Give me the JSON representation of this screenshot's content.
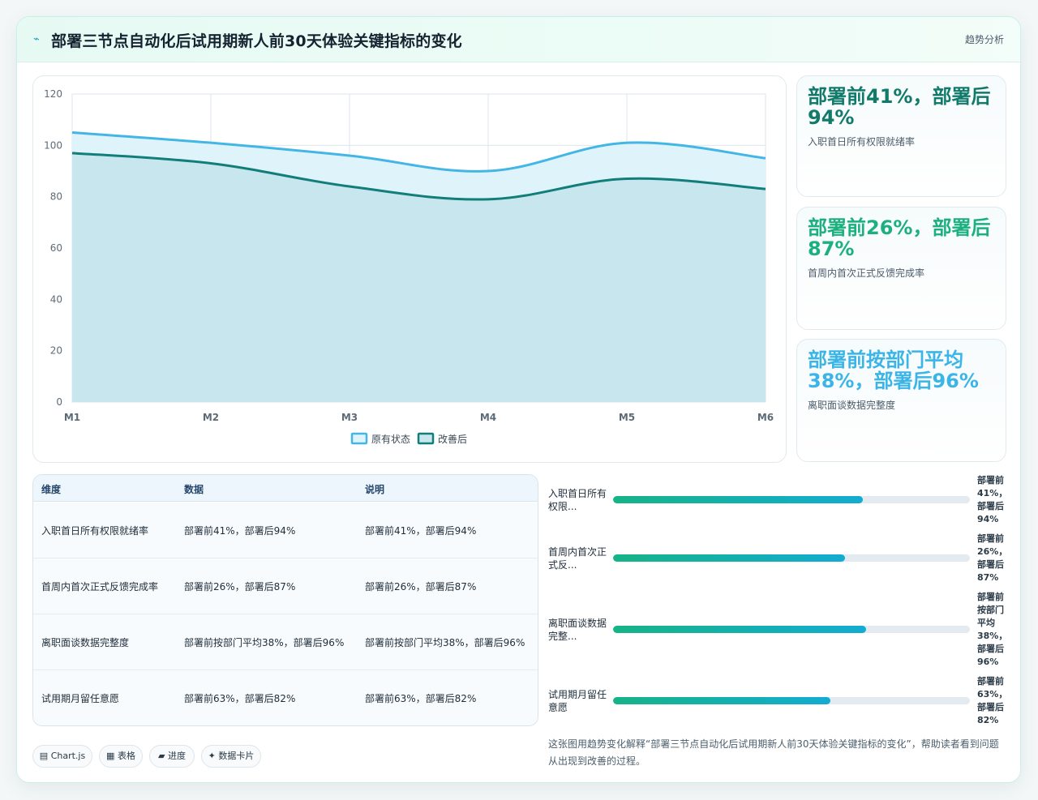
{
  "header": {
    "title": "部署三节点自动化后试用期新人前30天体验关键指标的变化",
    "tag": "趋势分析",
    "logo_icon": "spark-icon"
  },
  "chart_data": {
    "type": "area",
    "categories": [
      "M1",
      "M2",
      "M3",
      "M4",
      "M5",
      "M6"
    ],
    "series": [
      {
        "name": "原有状态",
        "values": [
          105,
          101,
          96,
          90,
          101,
          95
        ],
        "color": "#43b6e6",
        "fill": "#dff3fb"
      },
      {
        "name": "改善后",
        "values": [
          97,
          93,
          84,
          79,
          87,
          83
        ],
        "color": "#127e7a",
        "fill": "#c8e6ee"
      }
    ],
    "ylim": [
      0,
      120
    ],
    "yticks": [
      0,
      20,
      40,
      60,
      80,
      100,
      120
    ],
    "grid": true,
    "legend": "bottom"
  },
  "kpis": [
    {
      "value": "部署前41%，部署后94%",
      "label": "入职首日所有权限就绪率",
      "color": "#117a6b"
    },
    {
      "value": "部署前26%，部署后87%",
      "label": "首周内首次正式反馈完成率",
      "color": "#1bb07e"
    },
    {
      "value": "部署前按部门平均38%，部署后96%",
      "label": "离职面谈数据完整度",
      "color": "#3bb5e8"
    }
  ],
  "table": {
    "headers": [
      "维度",
      "数据",
      "说明"
    ],
    "rows": [
      [
        "入职首日所有权限就绪率",
        "部署前41%，部署后94%",
        "部署前41%，部署后94%"
      ],
      [
        "首周内首次正式反馈完成率",
        "部署前26%，部署后87%",
        "部署前26%，部署后87%"
      ],
      [
        "离职面谈数据完整度",
        "部署前按部门平均38%，部署后96%",
        "部署前按部门平均38%，部署后96%"
      ],
      [
        "试用期月留任意愿",
        "部署前63%，部署后82%",
        "部署前63%，部署后82%"
      ]
    ]
  },
  "progress": [
    {
      "label": "入职首日所有权限...",
      "value": "部署前41%，部署后94%",
      "percent": 70
    },
    {
      "label": "首周内首次正式反...",
      "value": "部署前26%，部署后87%",
      "percent": 65
    },
    {
      "label": "离职面谈数据完整...",
      "value": "部署前按部门平均38%，部署后96%",
      "percent": 71
    },
    {
      "label": "试用期月留任意愿",
      "value": "部署前63%，部署后82%",
      "percent": 61
    }
  ],
  "chips": [
    {
      "icon": "▤",
      "label": "Chart.js"
    },
    {
      "icon": "▦",
      "label": "表格"
    },
    {
      "icon": "▰",
      "label": "进度"
    },
    {
      "icon": "✦",
      "label": "数据卡片"
    }
  ],
  "note": "这张图用趋势变化解释“部署三节点自动化后试用期新人前30天体验关键指标的变化”，帮助读者看到问题从出现到改善的过程。"
}
